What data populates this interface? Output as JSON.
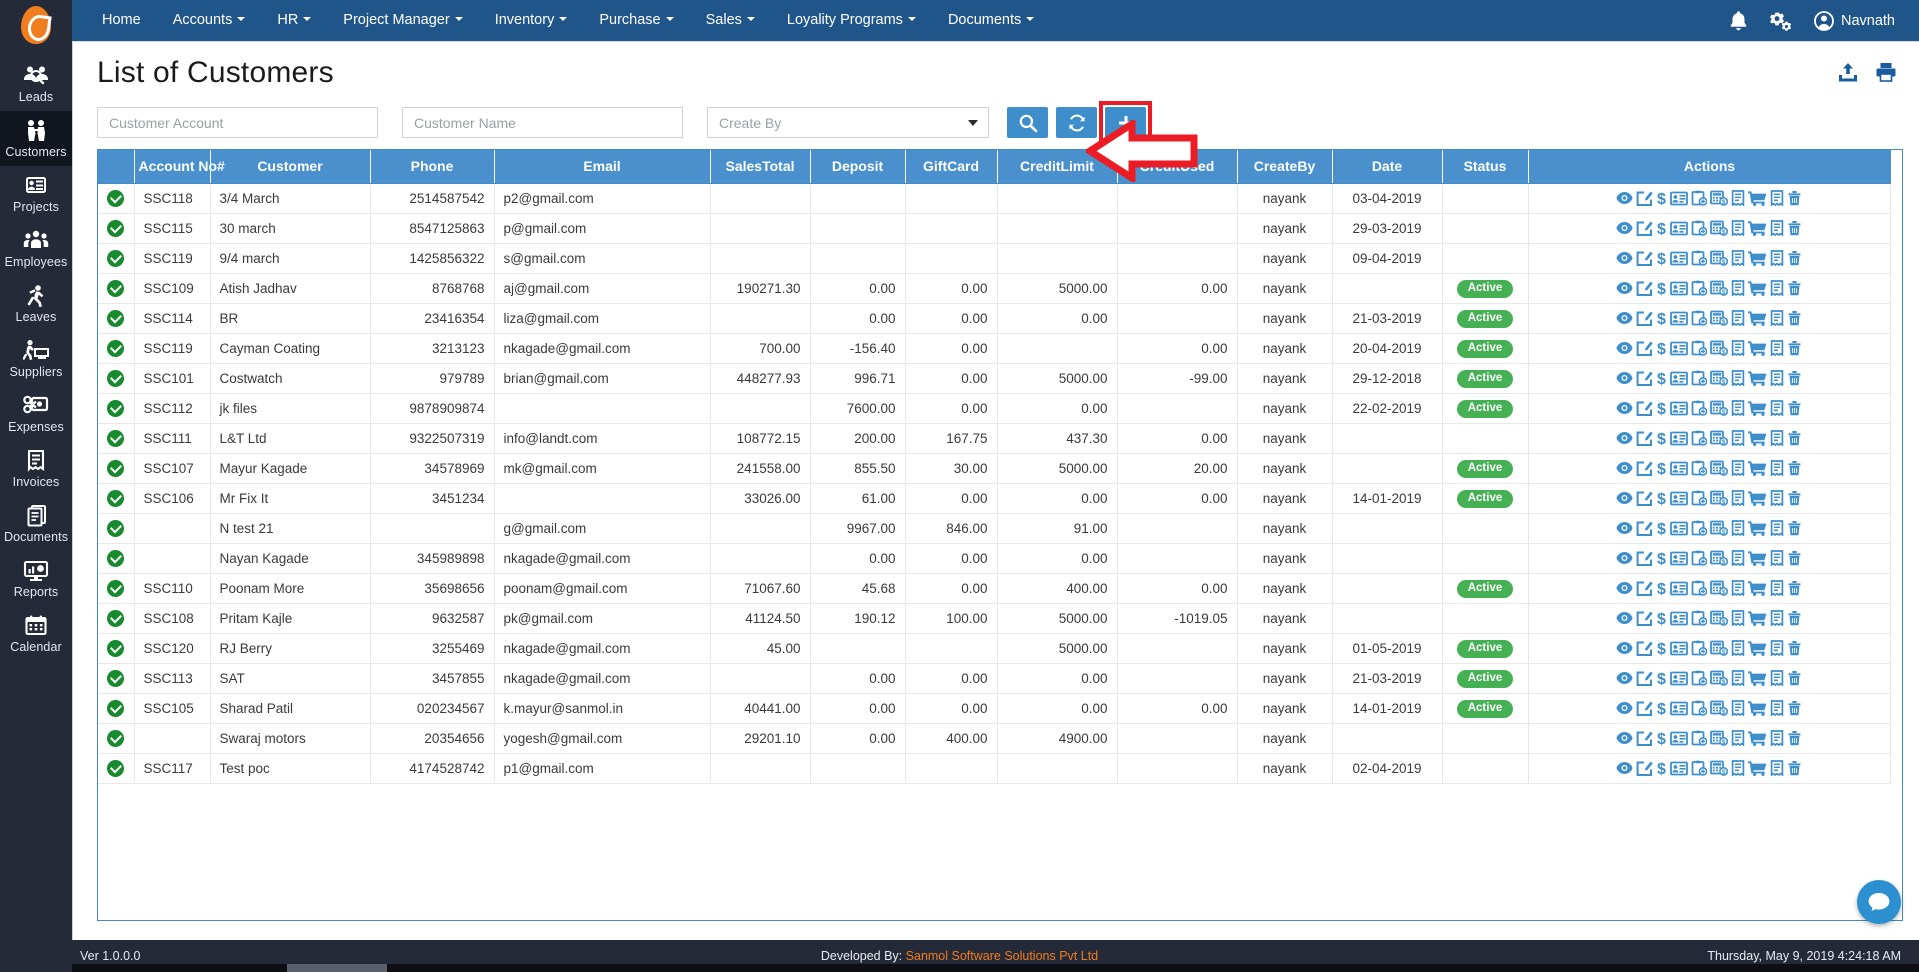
{
  "brand": {
    "logo_icon": "egg-logo"
  },
  "topnav": {
    "items": [
      {
        "label": "Home",
        "caret": false
      },
      {
        "label": "Accounts",
        "caret": true
      },
      {
        "label": "HR",
        "caret": true
      },
      {
        "label": "Project Manager",
        "caret": true
      },
      {
        "label": "Inventory",
        "caret": true
      },
      {
        "label": "Purchase",
        "caret": true
      },
      {
        "label": "Sales",
        "caret": true
      },
      {
        "label": "Loyality Programs",
        "caret": true
      },
      {
        "label": "Documents",
        "caret": true
      }
    ],
    "bell_icon": "notification-bell-icon",
    "settings_icon": "gears-icon",
    "user_name": "Navnath",
    "user_icon": "user-avatar-icon",
    "bg_color": "#20558a"
  },
  "sidebar": {
    "bg_color": "#242a38",
    "items": [
      {
        "label": "Leads",
        "icon": "leads-icon",
        "active": false
      },
      {
        "label": "Customers",
        "icon": "customers-icon",
        "active": true
      },
      {
        "label": "Projects",
        "icon": "projects-icon",
        "active": false
      },
      {
        "label": "Employees",
        "icon": "employees-icon",
        "active": false
      },
      {
        "label": "Leaves",
        "icon": "leaves-icon",
        "active": false
      },
      {
        "label": "Suppliers",
        "icon": "suppliers-icon",
        "active": false
      },
      {
        "label": "Expenses",
        "icon": "expenses-icon",
        "active": false
      },
      {
        "label": "Invoices",
        "icon": "invoices-icon",
        "active": false
      },
      {
        "label": "Documents",
        "icon": "documents-icon",
        "active": false
      },
      {
        "label": "Reports",
        "icon": "reports-icon",
        "active": false
      },
      {
        "label": "Calendar",
        "icon": "calendar-icon",
        "active": false
      }
    ]
  },
  "page": {
    "title": "List of Customers",
    "upload_icon": "upload-icon",
    "print_icon": "print-icon"
  },
  "filters": {
    "account_placeholder": "Customer Account",
    "account_value": "",
    "name_placeholder": "Customer Name",
    "name_value": "",
    "createby_placeholder": "Create By",
    "createby_value": "",
    "search_button_icon": "search-icon",
    "refresh_button_icon": "refresh-icon",
    "add_button_icon": "plus-icon",
    "accent_color": "#3e8ecc",
    "annotation_color": "#ec1c24"
  },
  "table": {
    "header_bg": "#4a90cd",
    "columns": [
      "Account No#",
      "Customer",
      "Phone",
      "Email",
      "SalesTotal",
      "Deposit",
      "GiftCard",
      "CreditLimit",
      "CreditUsed",
      "CreateBy",
      "Date",
      "Status",
      "Actions"
    ],
    "action_icons": [
      "view-eye-icon",
      "edit-icon",
      "dollar-icon",
      "contact-card-icon",
      "clipboard-add-icon",
      "calculator-dollar-icon",
      "invoice-icon",
      "cart-icon",
      "receipt-icon",
      "delete-trash-icon"
    ],
    "status_active_label": "Active",
    "status_active_color": "#46b054",
    "rows": [
      {
        "check": true,
        "account": "SSC118",
        "customer": "3/4 March",
        "phone": "2514587542",
        "email": "p2@gmail.com",
        "salestotal": "",
        "deposit": "",
        "giftcard": "",
        "creditlimit": "",
        "creditused": "",
        "createby": "nayank",
        "date": "03-04-2019",
        "status": ""
      },
      {
        "check": true,
        "account": "SSC115",
        "customer": "30 march",
        "phone": "8547125863",
        "email": "p@gmail.com",
        "salestotal": "",
        "deposit": "",
        "giftcard": "",
        "creditlimit": "",
        "creditused": "",
        "createby": "nayank",
        "date": "29-03-2019",
        "status": ""
      },
      {
        "check": true,
        "account": "SSC119",
        "customer": "9/4 march",
        "phone": "1425856322",
        "email": "s@gmail.com",
        "salestotal": "",
        "deposit": "",
        "giftcard": "",
        "creditlimit": "",
        "creditused": "",
        "createby": "nayank",
        "date": "09-04-2019",
        "status": ""
      },
      {
        "check": true,
        "account": "SSC109",
        "customer": "Atish Jadhav",
        "phone": "8768768",
        "email": "aj@gmail.com",
        "salestotal": "190271.30",
        "deposit": "0.00",
        "giftcard": "0.00",
        "creditlimit": "5000.00",
        "creditused": "0.00",
        "createby": "nayank",
        "date": "",
        "status": "Active"
      },
      {
        "check": true,
        "account": "SSC114",
        "customer": "BR",
        "phone": "23416354",
        "email": "liza@gmail.com",
        "salestotal": "",
        "deposit": "0.00",
        "giftcard": "0.00",
        "creditlimit": "0.00",
        "creditused": "",
        "createby": "nayank",
        "date": "21-03-2019",
        "status": "Active"
      },
      {
        "check": true,
        "account": "SSC119",
        "customer": "Cayman Coating",
        "phone": "3213123",
        "email": "nkagade@gmail.com",
        "salestotal": "700.00",
        "deposit": "-156.40",
        "giftcard": "0.00",
        "creditlimit": "",
        "creditused": "0.00",
        "createby": "nayank",
        "date": "20-04-2019",
        "status": "Active"
      },
      {
        "check": true,
        "account": "SSC101",
        "customer": "Costwatch",
        "phone": "979789",
        "email": "brian@gmail.com",
        "salestotal": "448277.93",
        "deposit": "996.71",
        "giftcard": "0.00",
        "creditlimit": "5000.00",
        "creditused": "-99.00",
        "createby": "nayank",
        "date": "29-12-2018",
        "status": "Active"
      },
      {
        "check": true,
        "account": "SSC112",
        "customer": "jk files",
        "phone": "9878909874",
        "email": "",
        "salestotal": "",
        "deposit": "7600.00",
        "giftcard": "0.00",
        "creditlimit": "0.00",
        "creditused": "",
        "createby": "nayank",
        "date": "22-02-2019",
        "status": "Active"
      },
      {
        "check": true,
        "account": "SSC111",
        "customer": "L&T Ltd",
        "phone": "9322507319",
        "email": "info@landt.com",
        "salestotal": "108772.15",
        "deposit": "200.00",
        "giftcard": "167.75",
        "creditlimit": "437.30",
        "creditused": "0.00",
        "createby": "nayank",
        "date": "",
        "status": ""
      },
      {
        "check": true,
        "account": "SSC107",
        "customer": "Mayur Kagade",
        "phone": "34578969",
        "email": "mk@gmail.com",
        "salestotal": "241558.00",
        "deposit": "855.50",
        "giftcard": "30.00",
        "creditlimit": "5000.00",
        "creditused": "20.00",
        "createby": "nayank",
        "date": "",
        "status": "Active"
      },
      {
        "check": true,
        "account": "SSC106",
        "customer": "Mr Fix It",
        "phone": "3451234",
        "email": "",
        "salestotal": "33026.00",
        "deposit": "61.00",
        "giftcard": "0.00",
        "creditlimit": "0.00",
        "creditused": "0.00",
        "createby": "nayank",
        "date": "14-01-2019",
        "status": "Active"
      },
      {
        "check": true,
        "account": "",
        "customer": "N test 21",
        "phone": "",
        "email": "g@gmail.com",
        "salestotal": "",
        "deposit": "9967.00",
        "giftcard": "846.00",
        "creditlimit": "91.00",
        "creditused": "",
        "createby": "nayank",
        "date": "",
        "status": ""
      },
      {
        "check": true,
        "account": "",
        "customer": "Nayan Kagade",
        "phone": "345989898",
        "email": "nkagade@gmail.com",
        "salestotal": "",
        "deposit": "0.00",
        "giftcard": "0.00",
        "creditlimit": "0.00",
        "creditused": "",
        "createby": "nayank",
        "date": "",
        "status": ""
      },
      {
        "check": true,
        "account": "SSC110",
        "customer": "Poonam More",
        "phone": "35698656",
        "email": "poonam@gmail.com",
        "salestotal": "71067.60",
        "deposit": "45.68",
        "giftcard": "0.00",
        "creditlimit": "400.00",
        "creditused": "0.00",
        "createby": "nayank",
        "date": "",
        "status": "Active"
      },
      {
        "check": true,
        "account": "SSC108",
        "customer": "Pritam Kajle",
        "phone": "9632587",
        "email": "pk@gmail.com",
        "salestotal": "41124.50",
        "deposit": "190.12",
        "giftcard": "100.00",
        "creditlimit": "5000.00",
        "creditused": "-1019.05",
        "createby": "nayank",
        "date": "",
        "status": ""
      },
      {
        "check": true,
        "account": "SSC120",
        "customer": "RJ Berry",
        "phone": "3255469",
        "email": "nkagade@gmail.com",
        "salestotal": "45.00",
        "deposit": "",
        "giftcard": "",
        "creditlimit": "5000.00",
        "creditused": "",
        "createby": "nayank",
        "date": "01-05-2019",
        "status": "Active"
      },
      {
        "check": true,
        "account": "SSC113",
        "customer": "SAT",
        "phone": "3457855",
        "email": "nkagade@gmail.com",
        "salestotal": "",
        "deposit": "0.00",
        "giftcard": "0.00",
        "creditlimit": "0.00",
        "creditused": "",
        "createby": "nayank",
        "date": "21-03-2019",
        "status": "Active"
      },
      {
        "check": true,
        "account": "SSC105",
        "customer": "Sharad Patil",
        "phone": "020234567",
        "email": "k.mayur@sanmol.in",
        "salestotal": "40441.00",
        "deposit": "0.00",
        "giftcard": "0.00",
        "creditlimit": "0.00",
        "creditused": "0.00",
        "createby": "nayank",
        "date": "14-01-2019",
        "status": "Active"
      },
      {
        "check": true,
        "account": "",
        "customer": "Swaraj motors",
        "phone": "20354656",
        "email": "yogesh@gmail.com",
        "salestotal": "29201.10",
        "deposit": "0.00",
        "giftcard": "400.00",
        "creditlimit": "4900.00",
        "creditused": "",
        "createby": "nayank",
        "date": "",
        "status": ""
      },
      {
        "check": true,
        "account": "SSC117",
        "customer": "Test poc",
        "phone": "4174528742",
        "email": "p1@gmail.com",
        "salestotal": "",
        "deposit": "",
        "giftcard": "",
        "creditlimit": "",
        "creditused": "",
        "createby": "nayank",
        "date": "02-04-2019",
        "status": ""
      }
    ]
  },
  "footer": {
    "version": "Ver 1.0.0.0",
    "developed_prefix": "Developed By:",
    "developed_by": "Sanmol Software Solutions Pvt Ltd",
    "timestamp": "Thursday, May 9, 2019 4:24:18 AM",
    "link_color": "#f07d1e"
  },
  "chat": {
    "icon": "chat-bubble-icon",
    "color": "#2c8fd0"
  }
}
